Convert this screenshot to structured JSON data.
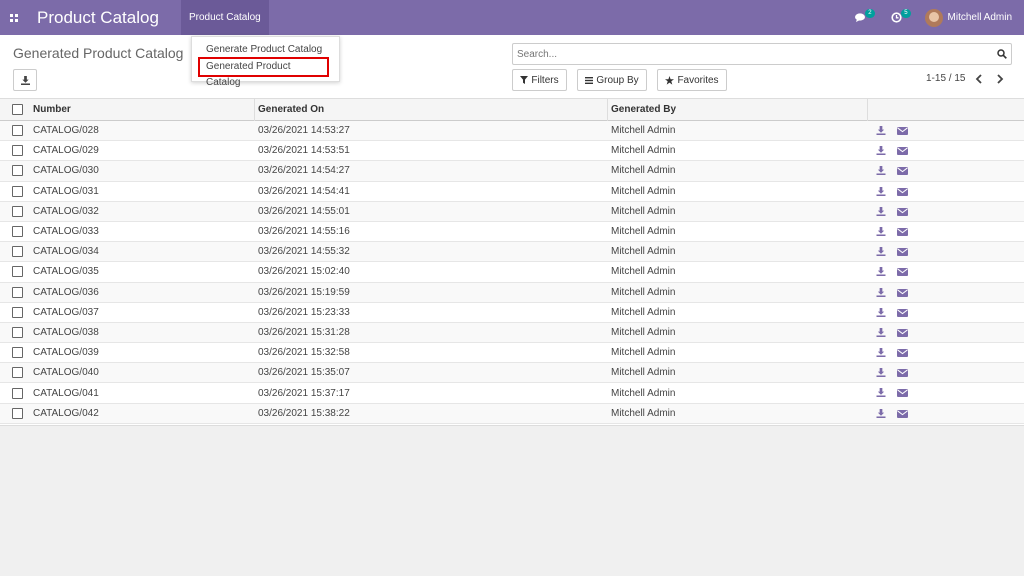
{
  "header": {
    "app_title": "Product Catalog",
    "menu_label": "Product Catalog",
    "messages_count": "2",
    "activities_count": "5",
    "user_name": "Mitchell Admin",
    "accent_color": "#7c6ba9"
  },
  "dropdown": {
    "items": [
      "Generate Product Catalog",
      "Generated Product Catalog"
    ]
  },
  "control": {
    "page_title": "Generated Product Catalog",
    "search_placeholder": "Search...",
    "filters_label": "Filters",
    "group_by_label": "Group By",
    "favorites_label": "Favorites",
    "pager": "1-15 / 15"
  },
  "table": {
    "columns": [
      "Number",
      "Generated On",
      "Generated By"
    ],
    "rows": [
      {
        "number": "CATALOG/028",
        "date": "03/26/2021 14:53:27",
        "by": "Mitchell Admin"
      },
      {
        "number": "CATALOG/029",
        "date": "03/26/2021 14:53:51",
        "by": "Mitchell Admin"
      },
      {
        "number": "CATALOG/030",
        "date": "03/26/2021 14:54:27",
        "by": "Mitchell Admin"
      },
      {
        "number": "CATALOG/031",
        "date": "03/26/2021 14:54:41",
        "by": "Mitchell Admin"
      },
      {
        "number": "CATALOG/032",
        "date": "03/26/2021 14:55:01",
        "by": "Mitchell Admin"
      },
      {
        "number": "CATALOG/033",
        "date": "03/26/2021 14:55:16",
        "by": "Mitchell Admin"
      },
      {
        "number": "CATALOG/034",
        "date": "03/26/2021 14:55:32",
        "by": "Mitchell Admin"
      },
      {
        "number": "CATALOG/035",
        "date": "03/26/2021 15:02:40",
        "by": "Mitchell Admin"
      },
      {
        "number": "CATALOG/036",
        "date": "03/26/2021 15:19:59",
        "by": "Mitchell Admin"
      },
      {
        "number": "CATALOG/037",
        "date": "03/26/2021 15:23:33",
        "by": "Mitchell Admin"
      },
      {
        "number": "CATALOG/038",
        "date": "03/26/2021 15:31:28",
        "by": "Mitchell Admin"
      },
      {
        "number": "CATALOG/039",
        "date": "03/26/2021 15:32:58",
        "by": "Mitchell Admin"
      },
      {
        "number": "CATALOG/040",
        "date": "03/26/2021 15:35:07",
        "by": "Mitchell Admin"
      },
      {
        "number": "CATALOG/041",
        "date": "03/26/2021 15:37:17",
        "by": "Mitchell Admin"
      },
      {
        "number": "CATALOG/042",
        "date": "03/26/2021 15:38:22",
        "by": "Mitchell Admin"
      }
    ]
  },
  "icons": {
    "row_download": "download-icon",
    "row_email": "envelope-icon",
    "action_color": "#7c6ba9"
  }
}
